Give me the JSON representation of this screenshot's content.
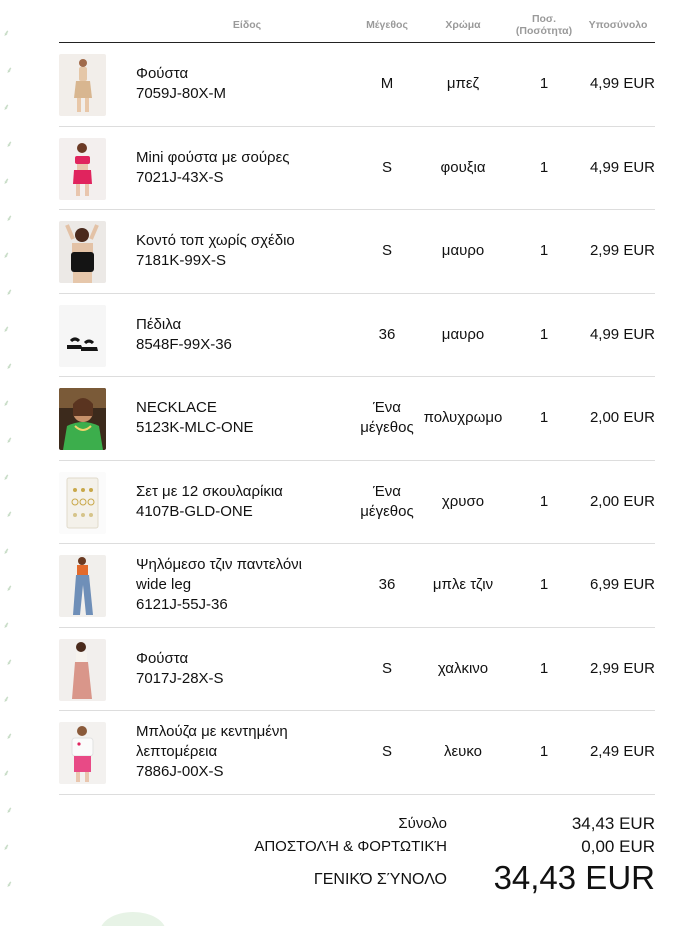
{
  "header": {
    "item": "Είδος",
    "size": "Μέγεθος",
    "color": "Χρώμα",
    "qty_line1": "Ποσ.",
    "qty_line2": "(Ποσότητα)",
    "subtotal": "Υποσύνολο"
  },
  "items": [
    {
      "name_lines": [
        "Φούστα",
        "7059J-80X-M"
      ],
      "size_lines": [
        "M"
      ],
      "color": "μπεζ",
      "qty": "1",
      "subtotal": "4,99 EUR",
      "thumb_icon": "beige-skirt-photo"
    },
    {
      "name_lines": [
        "Mini φούστα με σούρες",
        "7021J-43X-S"
      ],
      "size_lines": [
        "S"
      ],
      "color": "φουξια",
      "qty": "1",
      "subtotal": "4,99 EUR",
      "thumb_icon": "fuchsia-skirt-photo"
    },
    {
      "name_lines": [
        "Κοντό τοπ χωρίς σχέδιο",
        "7181K-99X-S"
      ],
      "size_lines": [
        "S"
      ],
      "color": "μαυρο",
      "qty": "1",
      "subtotal": "2,99 EUR",
      "thumb_icon": "black-top-photo"
    },
    {
      "name_lines": [
        "Πέδιλα",
        "8548F-99X-36"
      ],
      "size_lines": [
        "36"
      ],
      "color": "μαυρο",
      "qty": "1",
      "subtotal": "4,99 EUR",
      "thumb_icon": "black-sandals-photo"
    },
    {
      "name_lines": [
        "NECKLACE",
        "5123K-MLC-ONE"
      ],
      "size_lines": [
        "Ένα",
        "μέγεθος"
      ],
      "color": "πολυχρωμο",
      "qty": "1",
      "subtotal": "2,00 EUR",
      "thumb_icon": "necklace-photo"
    },
    {
      "name_lines": [
        "Σετ με 12 σκουλαρίκια",
        "4107B-GLD-ONE"
      ],
      "size_lines": [
        "Ένα",
        "μέγεθος"
      ],
      "color": "χρυσο",
      "qty": "1",
      "subtotal": "2,00 EUR",
      "thumb_icon": "earrings-set-photo"
    },
    {
      "name_lines": [
        "Ψηλόμεσο τζιν παντελόνι",
        "wide leg",
        "6121J-55J-36"
      ],
      "size_lines": [
        "36"
      ],
      "color": "μπλε τζιν",
      "qty": "1",
      "subtotal": "6,99 EUR",
      "thumb_icon": "wide-leg-jeans-photo"
    },
    {
      "name_lines": [
        "Φούστα",
        "7017J-28X-S"
      ],
      "size_lines": [
        "S"
      ],
      "color": "χαλκινο",
      "qty": "1",
      "subtotal": "2,99 EUR",
      "thumb_icon": "copper-skirt-photo"
    },
    {
      "name_lines": [
        "Μπλούζα με κεντημένη",
        "λεπτομέρεια",
        "7886J-00X-S"
      ],
      "size_lines": [
        "S"
      ],
      "color": "λευκο",
      "qty": "1",
      "subtotal": "2,49 EUR",
      "thumb_icon": "white-blouse-photo"
    }
  ],
  "totals": {
    "sum_label": "Σύνολο",
    "sum_value": "34,43 EUR",
    "shipping_label": "ΑΠΟΣΤΟΛΉ & ΦΟΡΤΩΤΙΚΉ",
    "shipping_value": "0,00 EUR",
    "grand_label": "ΓΕΝΙΚΌ ΣΎΝΟΛΟ",
    "grand_value": "34,43 EUR"
  },
  "colors": {
    "header_text": "#9a9a9a",
    "row_divider": "#dddddd",
    "header_rule": "#222222"
  }
}
